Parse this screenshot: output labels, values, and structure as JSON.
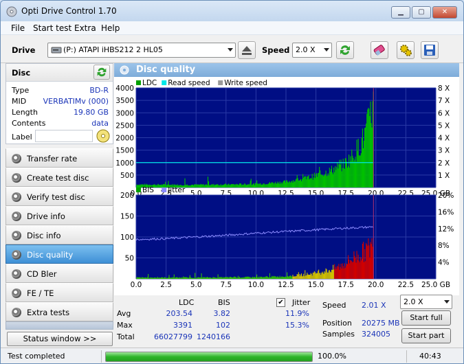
{
  "window": {
    "title": "Opti Drive Control 1.70"
  },
  "menu": [
    "File",
    "Start test",
    "Extra",
    "Help"
  ],
  "toolbar": {
    "drive_label": "Drive",
    "drive_value": "(P:)   ATAPI iHBS212   2 HL05",
    "speed_label": "Speed",
    "speed_value": "2.0 X"
  },
  "disc": {
    "title": "Disc",
    "rows": [
      {
        "key": "Type",
        "value": "BD-R"
      },
      {
        "key": "MID",
        "value": "VERBATIMv (000)"
      },
      {
        "key": "Length",
        "value": "19.80 GB"
      },
      {
        "key": "Contents",
        "value": "data"
      }
    ],
    "label_key": "Label",
    "label_value": ""
  },
  "nav": {
    "items": [
      {
        "label": "Transfer rate",
        "active": false
      },
      {
        "label": "Create test disc",
        "active": false
      },
      {
        "label": "Verify test disc",
        "active": false
      },
      {
        "label": "Drive info",
        "active": false
      },
      {
        "label": "Disc info",
        "active": false
      },
      {
        "label": "Disc quality",
        "active": true
      },
      {
        "label": "CD Bler",
        "active": false
      },
      {
        "label": "FE / TE",
        "active": false
      },
      {
        "label": "Extra tests",
        "active": false
      }
    ],
    "status_button": "Status window >>"
  },
  "main": {
    "title": "Disc quality"
  },
  "chart_data": [
    {
      "type": "bar",
      "legend": [
        "LDC",
        "Read speed",
        "Write speed"
      ],
      "legend_colors": [
        "#00a000",
        "#00e8e8",
        "#9a9a9a"
      ],
      "x_ticks": [
        "0.0",
        "2.5",
        "5.0",
        "7.5",
        "10.0",
        "12.5",
        "15.0",
        "17.5",
        "20.0",
        "22.5",
        "25.0 GB"
      ],
      "y_ticks": [
        "4000",
        "3500",
        "3000",
        "2500",
        "2000",
        "1500",
        "1000",
        "500"
      ],
      "y2_ticks": [
        "8 X",
        "7 X",
        "6 X",
        "5 X",
        "4 X",
        "3 X",
        "2 X",
        "1 X"
      ],
      "xlim": [
        0,
        25
      ],
      "ylim": [
        0,
        4000
      ],
      "y2lim": [
        0,
        8
      ],
      "data_end_gb": 19.8,
      "ldc_profile": {
        "x": [
          0,
          2.5,
          5,
          7.5,
          10,
          12.5,
          14,
          15,
          16,
          17,
          17.5,
          18,
          18.5,
          19,
          19.5,
          19.8
        ],
        "y": [
          120,
          110,
          110,
          120,
          140,
          230,
          350,
          480,
          640,
          850,
          1000,
          1250,
          1600,
          2000,
          2800,
          3391
        ]
      },
      "read_speed_x": 2.0,
      "colors": {
        "ldc": "#00c000",
        "read_speed": "#00e8e8",
        "marker": "#b03070"
      }
    },
    {
      "type": "bar",
      "legend": [
        "BIS",
        "Jitter"
      ],
      "legend_colors": [
        "#00a000",
        "#8c8cff"
      ],
      "x_ticks": [
        "0.0",
        "2.5",
        "5.0",
        "7.5",
        "10.0",
        "12.5",
        "15.0",
        "17.5",
        "20.0",
        "22.5",
        "25.0 GB"
      ],
      "y_ticks": [
        "200",
        "150",
        "100",
        "50"
      ],
      "y2_ticks": [
        "20%",
        "16%",
        "12%",
        "8%",
        "4%"
      ],
      "xlim": [
        0,
        25
      ],
      "ylim": [
        0,
        200
      ],
      "y2lim": [
        0,
        20
      ],
      "data_end_gb": 19.8,
      "bis_profile": {
        "x": [
          0,
          5,
          10,
          12.5,
          14,
          15,
          16,
          17,
          18,
          19,
          19.8
        ],
        "y": [
          3,
          3,
          4,
          6,
          10,
          14,
          20,
          30,
          48,
          65,
          82
        ]
      },
      "jitter_profile": {
        "x": [
          0,
          2.5,
          5,
          7.5,
          10,
          12.5,
          15,
          17.5,
          19.8
        ],
        "y": [
          9.4,
          9.6,
          10.0,
          10.4,
          10.9,
          11.3,
          11.7,
          12.1,
          12.4
        ]
      },
      "colors": {
        "bis_low": "#30c000",
        "bis_mid": "#d0c000",
        "bis_high": "#d00000",
        "jitter": "#8c8cff",
        "marker": "#b03070"
      }
    }
  ],
  "stats": {
    "col_ldc": "LDC",
    "col_bis": "BIS",
    "jitter_label": "Jitter",
    "jitter_checked": true,
    "rows": [
      {
        "label": "Avg",
        "ldc": "203.54",
        "bis": "3.82",
        "jitter": "11.9%"
      },
      {
        "label": "Max",
        "ldc": "3391",
        "bis": "102",
        "jitter": "15.3%"
      },
      {
        "label": "Total",
        "ldc": "66027799",
        "bis": "1240166",
        "jitter": ""
      }
    ],
    "speed_label": "Speed",
    "speed_value": "2.01 X",
    "speed_select": "2.0 X",
    "position_label": "Position",
    "position_value": "20275 MB",
    "samples_label": "Samples",
    "samples_value": "324005",
    "start_full": "Start full",
    "start_part": "Start part"
  },
  "statusbar": {
    "text": "Test completed",
    "progress": 100.0,
    "progress_text": "100.0%",
    "time": "40:43"
  }
}
